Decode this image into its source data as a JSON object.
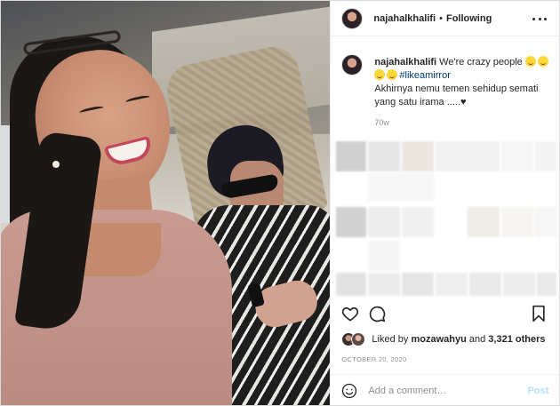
{
  "header": {
    "username": "najahalkhalifi",
    "separator": "•",
    "follow_status": "Following",
    "more_icon": "more-horizontal-icon"
  },
  "caption": {
    "username": "najahalkhalifi",
    "text_part1": "We're crazy people",
    "hashtag": "#likeamirror",
    "text_line2": "Akhirnya nemu temen sehidup semati yang satu irama .....♥",
    "time": "70w"
  },
  "actions": {
    "like_icon": "heart-icon",
    "comment_icon": "comment-icon",
    "save_icon": "bookmark-icon"
  },
  "likes": {
    "prefix": "Liked by",
    "user": "mozawahyu",
    "middle": "and",
    "count": "3,321 others"
  },
  "date": "OCTOBER 20, 2020",
  "comment_box": {
    "placeholder": "Add a comment…",
    "post_label": "Post",
    "emoji_icon": "smile-icon"
  },
  "colors": {
    "link": "#00376b",
    "muted": "#8e8e8e",
    "post_disabled": "#b2dffc",
    "text": "#262626"
  }
}
